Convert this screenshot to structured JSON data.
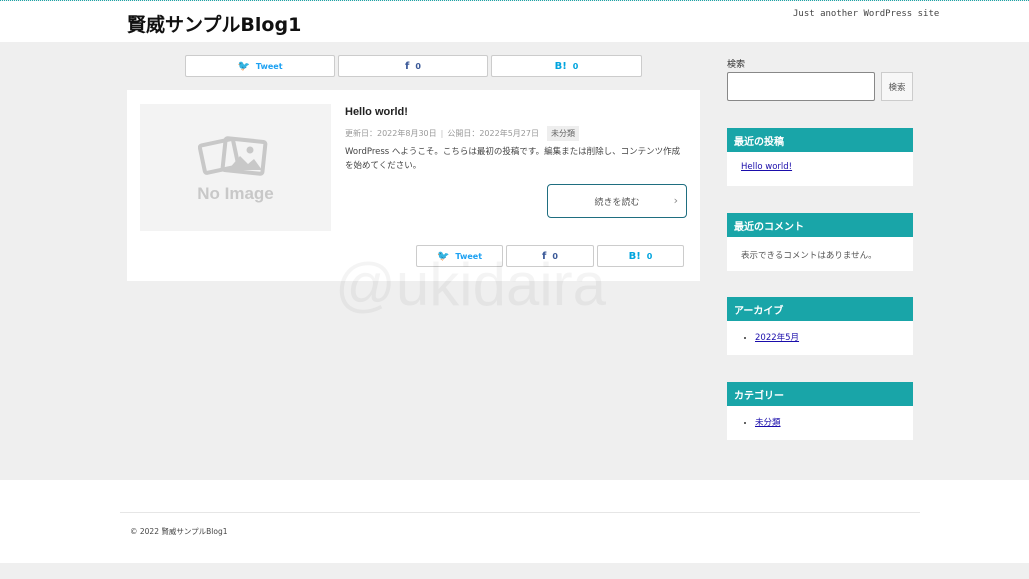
{
  "header": {
    "site_title": "賢威サンプルBlog1",
    "tagline": "Just another WordPress site"
  },
  "share": {
    "tweet_label": "Tweet",
    "fb_count": "0",
    "hb_label": "B!",
    "hb_count": "0"
  },
  "post": {
    "title": "Hello world!",
    "updated": "更新日：2022年8月30日",
    "published": "公開日：2022年5月27日",
    "category": "未分類",
    "excerpt": "WordPress へようこそ。こちらは最初の投稿です。編集または削除し、コンテンツ作成を始めてください。",
    "read_more": "続きを読む",
    "thumbnail_text": "No Image"
  },
  "watermark": "@ukidaira",
  "sidebar": {
    "search_label": "検索",
    "search_button": "検索",
    "recent_posts_title": "最近の投稿",
    "recent_posts": [
      "Hello world!"
    ],
    "recent_comments_title": "最近のコメント",
    "no_comments": "表示できるコメントはありません。",
    "archive_title": "アーカイブ",
    "archives": [
      "2022年5月"
    ],
    "category_title": "カテゴリー",
    "categories": [
      "未分類"
    ]
  },
  "footer": {
    "copyright": "© 2022 賢威サンプルBlog1"
  },
  "colors": {
    "accent": "#19a5a8",
    "twitter": "#1da1f2",
    "facebook": "#3b5998",
    "hatena": "#00a4de"
  }
}
